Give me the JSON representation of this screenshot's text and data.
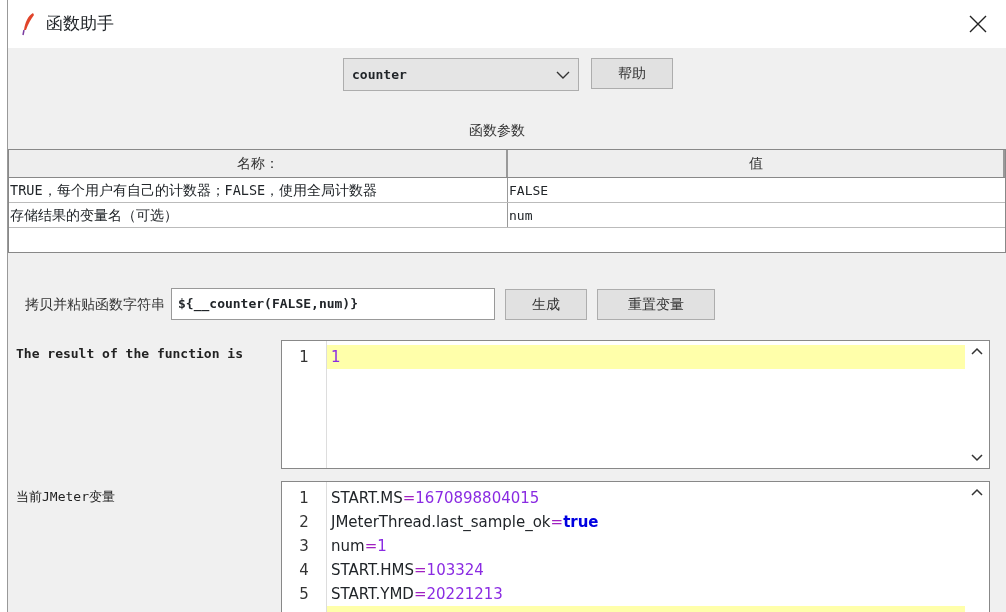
{
  "window": {
    "title": "函数助手"
  },
  "function_select": {
    "value": "counter"
  },
  "help_button": "帮助",
  "params_title": "函数参数",
  "params_table": {
    "columns": [
      "名称：",
      "值"
    ],
    "rows": [
      {
        "name": "TRUE，每个用户有自己的计数器；FALSE，使用全局计数器",
        "value": "FALSE"
      },
      {
        "name": "存储结果的变量名（可选）",
        "value": "num"
      }
    ]
  },
  "copy_label": "拷贝并粘贴函数字符串",
  "function_string": "${__counter(FALSE,num)}",
  "generate_button": "生成",
  "reset_button": "重置变量",
  "result": {
    "label": "The result of the function is",
    "lines": [
      {
        "number": "1",
        "value": "1",
        "kind": "number",
        "current": true
      }
    ]
  },
  "variables": {
    "label": "当前JMeter变量",
    "lines": [
      {
        "number": "1",
        "key": "START.MS",
        "operator": "=",
        "value": "1670898804015",
        "kind": "number",
        "current": false
      },
      {
        "number": "2",
        "key": "JMeterThread.last_sample_ok",
        "operator": "=",
        "value": "true",
        "kind": "boolean",
        "current": false
      },
      {
        "number": "3",
        "key": "num",
        "operator": "=",
        "value": "1",
        "kind": "number",
        "current": false
      },
      {
        "number": "4",
        "key": "START.HMS",
        "operator": "=",
        "value": "103324",
        "kind": "number",
        "current": false
      },
      {
        "number": "5",
        "key": "START.YMD",
        "operator": "=",
        "value": "20221213",
        "kind": "number",
        "current": false
      }
    ]
  }
}
